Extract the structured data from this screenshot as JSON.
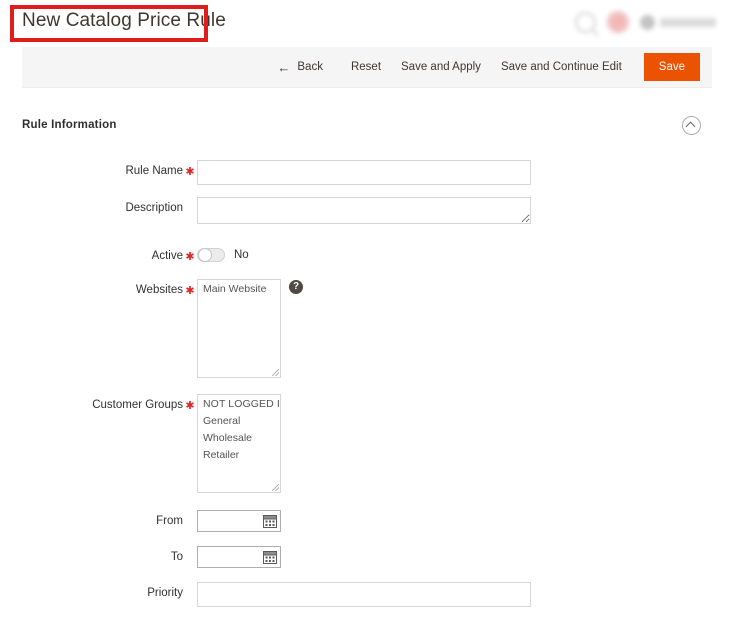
{
  "header": {
    "title": "New Catalog Price Rule",
    "search_icon": "search-icon",
    "notification_icon": "notification-bell-icon",
    "avatar_icon": "user-avatar-icon"
  },
  "toolbar": {
    "back_label": "Back",
    "back_icon": "arrow-left-icon",
    "reset_label": "Reset",
    "save_and_apply_label": "Save and Apply",
    "save_and_continue_label": "Save and Continue Edit",
    "save_label": "Save",
    "primary_color": "#eb5202"
  },
  "section": {
    "title": "Rule Information",
    "collapse_icon": "chevron-up-circle-icon"
  },
  "fields": {
    "rule_name": {
      "label": "Rule Name",
      "required": true,
      "value": "",
      "placeholder": ""
    },
    "description": {
      "label": "Description",
      "required": false,
      "value": "",
      "placeholder": ""
    },
    "active": {
      "label": "Active",
      "required": true,
      "state_label": "No",
      "enabled": false
    },
    "websites": {
      "label": "Websites",
      "required": true,
      "options": [
        "Main Website"
      ],
      "help_icon": "question-mark-help-icon"
    },
    "customer_groups": {
      "label": "Customer Groups",
      "required": true,
      "options": [
        "NOT LOGGED IN",
        "General",
        "Wholesale",
        "Retailer"
      ]
    },
    "from": {
      "label": "From",
      "required": false,
      "value": "",
      "calendar_icon": "calendar-icon"
    },
    "to": {
      "label": "To",
      "required": false,
      "value": "",
      "calendar_icon": "calendar-icon"
    },
    "priority": {
      "label": "Priority",
      "required": false,
      "value": "",
      "placeholder": ""
    }
  },
  "annotation": {
    "color": "#e01d1d"
  }
}
